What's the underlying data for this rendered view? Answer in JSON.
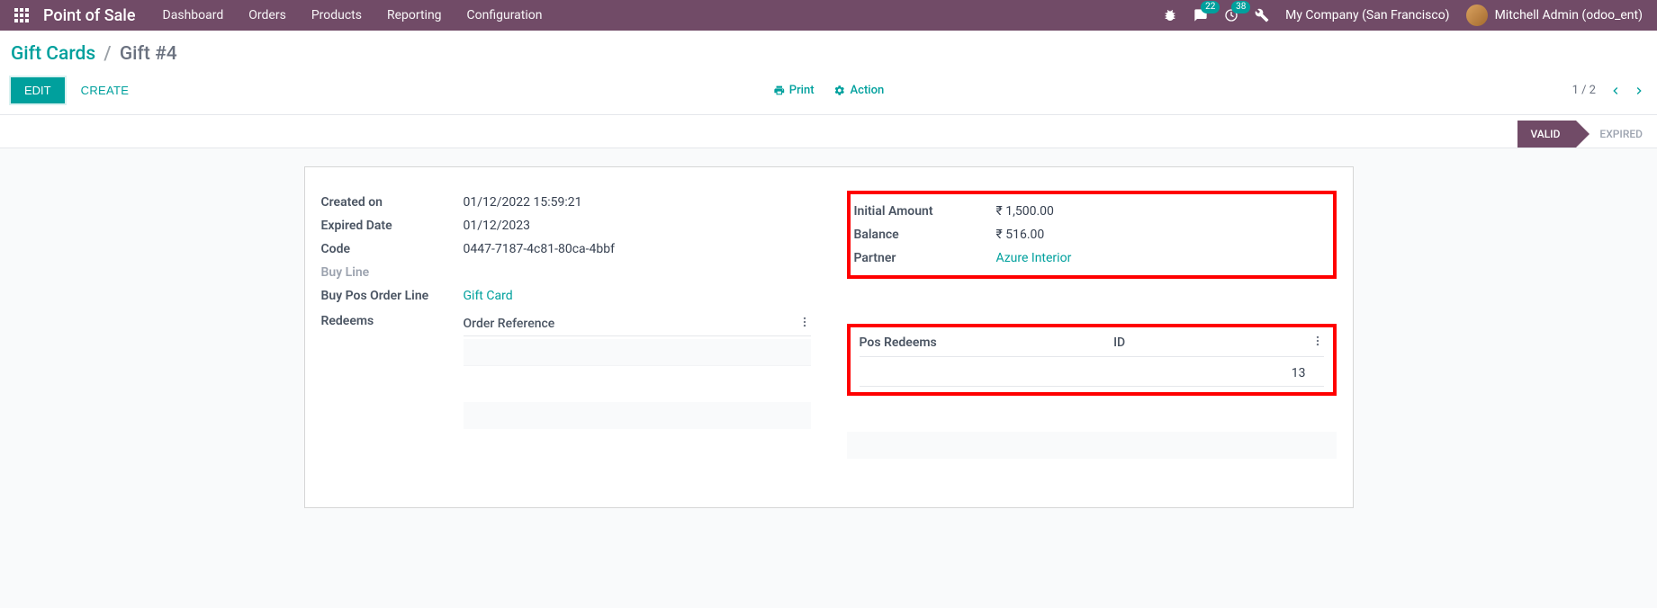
{
  "navbar": {
    "brand": "Point of Sale",
    "menu": [
      "Dashboard",
      "Orders",
      "Products",
      "Reporting",
      "Configuration"
    ],
    "messages_badge": "22",
    "activities_badge": "38",
    "company": "My Company (San Francisco)",
    "user": "Mitchell Admin (odoo_ent)"
  },
  "breadcrumb": {
    "back": "Gift Cards",
    "current": "Gift #4"
  },
  "control_panel": {
    "edit": "EDIT",
    "create": "CREATE",
    "print": "Print",
    "action": "Action",
    "pager": "1 / 2"
  },
  "statusbar": {
    "active": "VALID",
    "next": "EXPIRED"
  },
  "fields_left": {
    "created_on_label": "Created on",
    "created_on": "01/12/2022 15:59:21",
    "expired_date_label": "Expired Date",
    "expired_date": "01/12/2023",
    "code_label": "Code",
    "code": "0447-7187-4c81-80ca-4bbf",
    "buy_line_label": "Buy Line",
    "buy_pos_order_line_label": "Buy Pos Order Line",
    "buy_pos_order_line": "Gift Card",
    "redeems_label": "Redeems"
  },
  "fields_right": {
    "initial_amount_label": "Initial Amount",
    "initial_amount": "₹ 1,500.00",
    "balance_label": "Balance",
    "balance": "₹ 516.00",
    "partner_label": "Partner",
    "partner": "Azure Interior"
  },
  "redeems_list": {
    "header": "Order Reference"
  },
  "pos_redeems": {
    "title": "Pos Redeems",
    "id_header": "ID",
    "rows": [
      {
        "id": "13"
      }
    ]
  }
}
